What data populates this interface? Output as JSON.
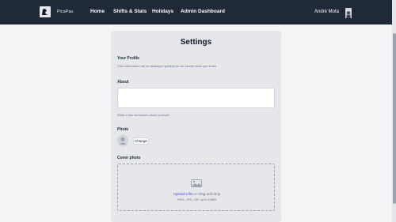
{
  "navbar": {
    "brand": "PicaPau",
    "links": [
      "Home",
      "Shifts & Stats",
      "Holidays",
      "Admin Dashboard"
    ],
    "user_name": "André Mota"
  },
  "settings": {
    "title": "Settings",
    "profile": {
      "heading": "Your Profile",
      "description": "This information will be displayed publicly so be careful what you share."
    },
    "about": {
      "label": "About",
      "value": "",
      "hint": "Write a few sentences about yourself."
    },
    "photo": {
      "label": "Photo",
      "change_button": "Change"
    },
    "cover_photo": {
      "label": "Cover photo",
      "upload_link": "Upload a file",
      "upload_suffix": " or drag and drop",
      "hint": "PNG, JPG, GIF up to 10MB"
    }
  },
  "colors": {
    "navbar_bg": "#1f2937",
    "card_bg": "#e5e7eb",
    "link": "#4f46e5"
  }
}
